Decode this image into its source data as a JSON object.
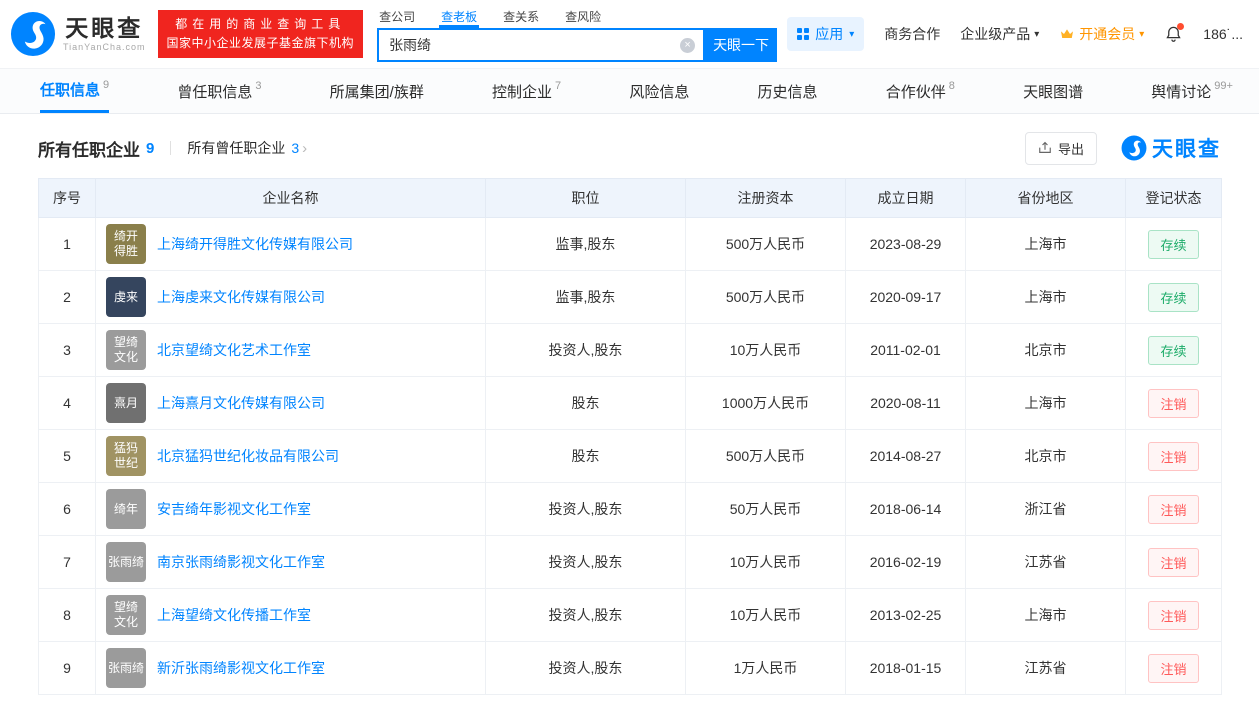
{
  "colors": {
    "accent": "#0084ff",
    "brand_red": "#f0251f",
    "vip_orange": "#ff9500",
    "status_green": "#1dac69",
    "status_red": "#ff5a5a"
  },
  "icons": {
    "chevron_down": "▾",
    "clear": "×",
    "arrow_right": "›"
  },
  "brand": {
    "name": "天眼查",
    "domain": "TianYanCha.com",
    "slogan_line1": "都在用的商业查询工具",
    "slogan_line2": "国家中小企业发展子基金旗下机构"
  },
  "search": {
    "tabs": [
      {
        "label": "查公司",
        "active": false
      },
      {
        "label": "查老板",
        "active": true
      },
      {
        "label": "查关系",
        "active": false
      },
      {
        "label": "查风险",
        "active": false
      }
    ],
    "value": "张雨绮",
    "button": "天眼一下"
  },
  "header_menu": {
    "apps": "应用",
    "business": "商务合作",
    "enterprise": "企业级产品",
    "vip": "开通会员",
    "user": "186˙..."
  },
  "nav_tabs": [
    {
      "label": "任职信息",
      "count": "9",
      "active": true
    },
    {
      "label": "曾任职信息",
      "count": "3",
      "active": false
    },
    {
      "label": "所属集团/族群",
      "count": "",
      "active": false
    },
    {
      "label": "控制企业",
      "count": "7",
      "active": false
    },
    {
      "label": "风险信息",
      "count": "",
      "active": false
    },
    {
      "label": "历史信息",
      "count": "",
      "active": false
    },
    {
      "label": "合作伙伴",
      "count": "8",
      "active": false
    },
    {
      "label": "天眼图谱",
      "count": "",
      "active": false
    },
    {
      "label": "舆情讨论",
      "count": "99+",
      "active": false
    }
  ],
  "section": {
    "title": "所有任职企业",
    "title_count": "9",
    "subtitle": "所有曾任职企业",
    "subtitle_count": "3",
    "export_label": "导出",
    "watermark": "天眼查"
  },
  "table": {
    "columns": [
      "序号",
      "企业名称",
      "职位",
      "注册资本",
      "成立日期",
      "省份地区",
      "登记状态"
    ],
    "rows": [
      {
        "no": "1",
        "logo_lines": [
          "绮开",
          "得胜"
        ],
        "logo_color": "#8a7f4b",
        "company": "上海绮开得胜文化传媒有限公司",
        "position": "监事,股东",
        "capital": "500万人民币",
        "date": "2023-08-29",
        "region": "上海市",
        "status": "存续",
        "status_type": "active"
      },
      {
        "no": "2",
        "logo_lines": [
          "虔来"
        ],
        "logo_color": "#35455e",
        "company": "上海虔来文化传媒有限公司",
        "position": "监事,股东",
        "capital": "500万人民币",
        "date": "2020-09-17",
        "region": "上海市",
        "status": "存续",
        "status_type": "active"
      },
      {
        "no": "3",
        "logo_lines": [
          "望绮",
          "文化"
        ],
        "logo_color": "#9b9b9b",
        "company": "北京望绮文化艺术工作室",
        "position": "投资人,股东",
        "capital": "10万人民币",
        "date": "2011-02-01",
        "region": "北京市",
        "status": "存续",
        "status_type": "active"
      },
      {
        "no": "4",
        "logo_lines": [
          "熹月"
        ],
        "logo_color": "#707070",
        "company": "上海熹月文化传媒有限公司",
        "position": "股东",
        "capital": "1000万人民币",
        "date": "2020-08-11",
        "region": "上海市",
        "status": "注销",
        "status_type": "cancelled"
      },
      {
        "no": "5",
        "logo_lines": [
          "猛犸",
          "世纪"
        ],
        "logo_color": "#a09363",
        "company": "北京猛犸世纪化妆品有限公司",
        "position": "股东",
        "capital": "500万人民币",
        "date": "2014-08-27",
        "region": "北京市",
        "status": "注销",
        "status_type": "cancelled"
      },
      {
        "no": "6",
        "logo_lines": [
          "绮年"
        ],
        "logo_color": "#9b9b9b",
        "company": "安吉绮年影视文化工作室",
        "position": "投资人,股东",
        "capital": "50万人民币",
        "date": "2018-06-14",
        "region": "浙江省",
        "status": "注销",
        "status_type": "cancelled"
      },
      {
        "no": "7",
        "logo_lines": [
          "张雨绮"
        ],
        "logo_color": "#9b9b9b",
        "company": "南京张雨绮影视文化工作室",
        "position": "投资人,股东",
        "capital": "10万人民币",
        "date": "2016-02-19",
        "region": "江苏省",
        "status": "注销",
        "status_type": "cancelled"
      },
      {
        "no": "8",
        "logo_lines": [
          "望绮",
          "文化"
        ],
        "logo_color": "#9b9b9b",
        "company": "上海望绮文化传播工作室",
        "position": "投资人,股东",
        "capital": "10万人民币",
        "date": "2013-02-25",
        "region": "上海市",
        "status": "注销",
        "status_type": "cancelled"
      },
      {
        "no": "9",
        "logo_lines": [
          "张雨绮"
        ],
        "logo_color": "#9b9b9b",
        "company": "新沂张雨绮影视文化工作室",
        "position": "投资人,股东",
        "capital": "1万人民币",
        "date": "2018-01-15",
        "region": "江苏省",
        "status": "注销",
        "status_type": "cancelled"
      }
    ]
  }
}
